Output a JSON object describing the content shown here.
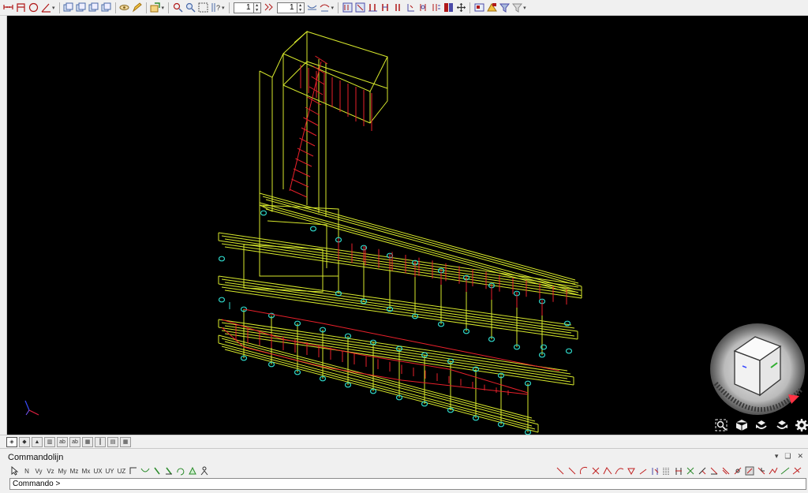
{
  "toolbar": {
    "spinners": [
      {
        "value": "1"
      },
      {
        "value": "1"
      }
    ]
  },
  "colors": {
    "viewport_bg": "#000000",
    "structure": "#d7e82c",
    "load": "#e8202a",
    "support": "#2fd6c8",
    "accent_red": "#ff3344"
  },
  "view_controls": {
    "icons": [
      "zoom-extents-icon",
      "view-cube-icon",
      "orbit-left-icon",
      "orbit-right-icon",
      "settings-icon"
    ]
  },
  "bottom_tabs": {
    "count": 13
  },
  "command_panel": {
    "title": "Commandolijn",
    "pin": "▾",
    "dock": "❑",
    "close": "✕",
    "prompt": "Commando >",
    "tool_labels": [
      "N",
      "Vy",
      "Vz",
      "My",
      "Mz",
      "Mx",
      "UX",
      "UY",
      "UZ"
    ]
  }
}
